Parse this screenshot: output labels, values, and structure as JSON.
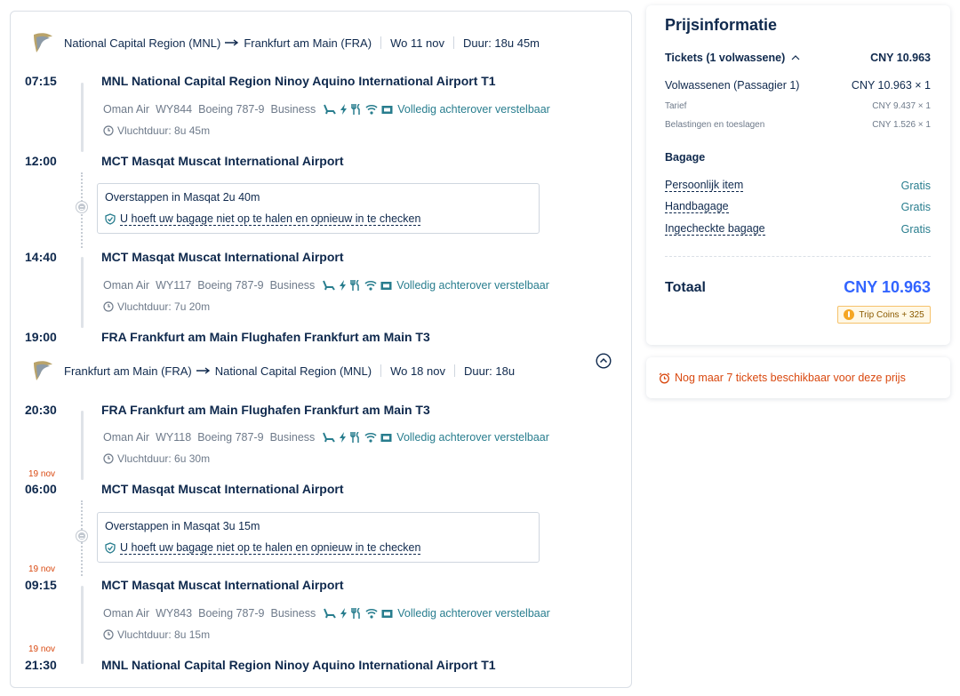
{
  "outbound": {
    "from": "National Capital Region (MNL)",
    "to": "Frankfurt am Main (FRA)",
    "date": "Wo 11 nov",
    "duration": "Duur: 18u 45m",
    "segments": [
      {
        "dep_time": "07:15",
        "dep_airport": "MNL National Capital Region Ninoy Aquino International Airport T1",
        "airline": "Oman Air",
        "flight_no": "WY844",
        "aircraft": "Boeing 787-9",
        "cabin": "Business",
        "seat": "Volledig achterover verstelbaar",
        "flight_duration": "Vluchtduur: 8u 45m",
        "arr_time": "12:00",
        "arr_airport": "MCT Masqat Muscat International Airport"
      },
      {
        "dep_time": "14:40",
        "dep_airport": "MCT Masqat Muscat International Airport",
        "airline": "Oman Air",
        "flight_no": "WY117",
        "aircraft": "Boeing 787-9",
        "cabin": "Business",
        "seat": "Volledig achterover verstelbaar",
        "flight_duration": "Vluchtduur: 7u 20m",
        "arr_time": "19:00",
        "arr_airport": "FRA Frankfurt am Main Flughafen Frankfurt am Main T3"
      }
    ],
    "transfer": {
      "title": "Overstappen in Masqat  2u 40m",
      "note": "U hoeft uw bagage niet op te halen en opnieuw in te checken"
    }
  },
  "return": {
    "from": "Frankfurt am Main (FRA)",
    "to": "National Capital Region (MNL)",
    "date": "Wo 18 nov",
    "duration": "Duur: 18u",
    "segments": [
      {
        "dep_time": "20:30",
        "dep_airport": "FRA Frankfurt am Main Flughafen Frankfurt am Main T3",
        "airline": "Oman Air",
        "flight_no": "WY118",
        "aircraft": "Boeing 787-9",
        "cabin": "Business",
        "seat": "Volledig achterover verstelbaar",
        "flight_duration": "Vluchtduur: 6u 30m",
        "arr_date_note": "19 nov",
        "arr_time": "06:00",
        "arr_airport": "MCT Masqat Muscat International Airport"
      },
      {
        "dep_date_note": "19 nov",
        "dep_time": "09:15",
        "dep_airport": "MCT Masqat Muscat International Airport",
        "airline": "Oman Air",
        "flight_no": "WY843",
        "aircraft": "Boeing 787-9",
        "cabin": "Business",
        "seat": "Volledig achterover verstelbaar",
        "flight_duration": "Vluchtduur: 8u 15m",
        "arr_date_note": "19 nov",
        "arr_time": "21:30",
        "arr_airport": "MNL National Capital Region Ninoy Aquino International Airport T1"
      }
    ],
    "transfer": {
      "title": "Overstappen in Masqat  3u 15m",
      "note": "U hoeft uw bagage niet op te halen en opnieuw in te checken"
    }
  },
  "price": {
    "title": "Prijsinformatie",
    "tickets_label": "Tickets (1 volwassene)",
    "tickets_total": "CNY 10.963",
    "pax_label": "Volwassenen (Passagier 1)",
    "pax_value": "CNY 10.963 × 1",
    "tarief_label": "Tarief",
    "tarief_value": "CNY 9.437 × 1",
    "tax_label": "Belastingen en toeslagen",
    "tax_value": "CNY 1.526 × 1",
    "baggage_title": "Bagage",
    "baggage": [
      {
        "label": "Persoonlijk item",
        "value": "Gratis"
      },
      {
        "label": "Handbagage",
        "value": "Gratis"
      },
      {
        "label": "Ingecheckte bagage",
        "value": "Gratis"
      }
    ],
    "total_label": "Totaal",
    "total_value": "CNY 10.963",
    "coins": "Trip Coins + 325"
  },
  "availability": "Nog maar 7 tickets beschikbaar voor deze prijs",
  "colors": {
    "text": "#0f294d",
    "muted": "#6e7a8a",
    "teal": "#287d8e",
    "accent_blue": "#3264ff",
    "warning": "#d9480f"
  },
  "icons": [
    "airline-logo-icon",
    "arrow-right-icon",
    "seat-icon",
    "power-icon",
    "meal-icon",
    "wifi-icon",
    "entertainment-icon",
    "clock-icon",
    "shield-icon",
    "collapse-up-icon",
    "chevron-up-icon",
    "coin-icon",
    "alarm-icon"
  ]
}
